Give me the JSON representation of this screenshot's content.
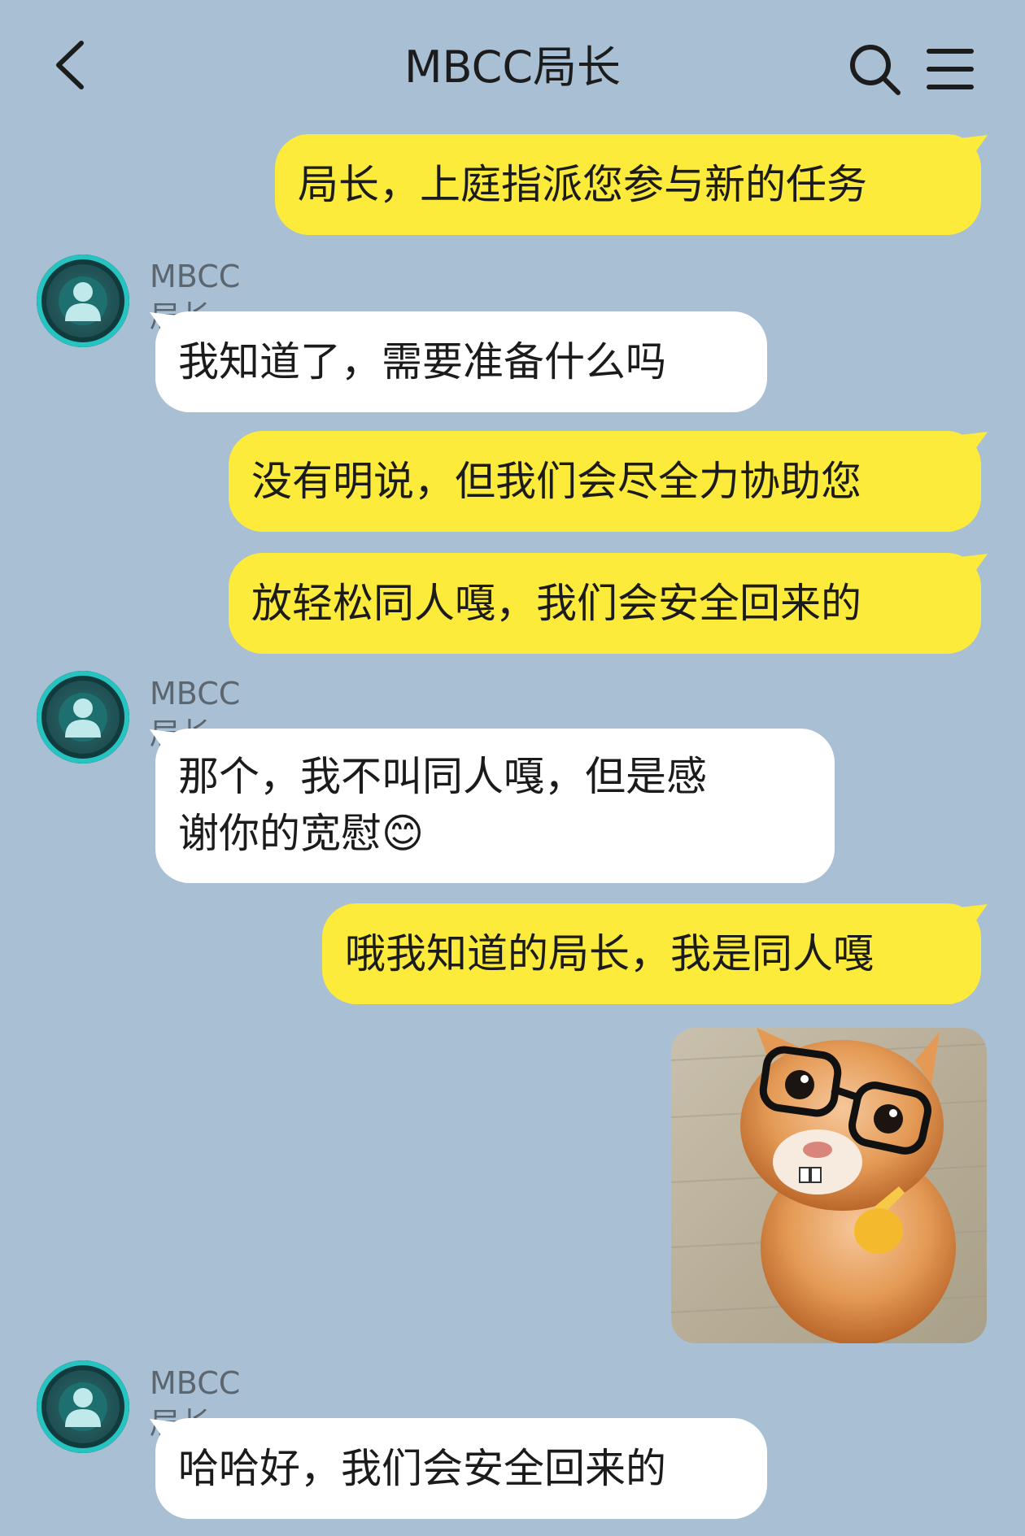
{
  "header": {
    "title": "MBCC局长",
    "back_icon": "chevron-left-icon",
    "search_icon": "search-icon",
    "menu_icon": "menu-icon"
  },
  "messages": [
    {
      "direction": "out",
      "text": "局长，上庭指派您参与新的任务"
    },
    {
      "direction": "in",
      "sender": "MBCC局长",
      "text": "我知道了，需要准备什么吗"
    },
    {
      "direction": "out",
      "text": "没有明说，但我们会尽全力协助您"
    },
    {
      "direction": "out",
      "text": "放轻松同人嘎，我们会安全回来的"
    },
    {
      "direction": "in",
      "sender": "MBCC局长",
      "text_line1": "那个，我不叫同人嘎，但是感",
      "text_line2": "谢你的宽慰😊"
    },
    {
      "direction": "out",
      "text": "哦我知道的局长，我是同人嘎"
    },
    {
      "direction": "out",
      "type": "image",
      "image": "kitten-with-glasses-sticker"
    },
    {
      "direction": "in",
      "sender": "MBCC局长",
      "text": "哈哈好，我们会安全回来的"
    }
  ],
  "colors": {
    "background": "#a9c0d4",
    "outgoing_bubble": "#fdeb3b",
    "incoming_bubble": "#ffffff"
  }
}
